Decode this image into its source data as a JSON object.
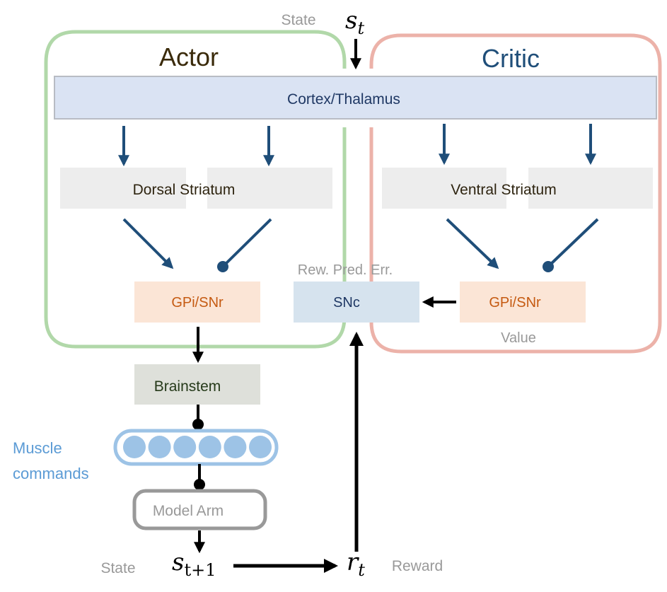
{
  "top": {
    "state_label": "State",
    "state_symbol": "s",
    "state_sub": "t"
  },
  "actor": {
    "title": "Actor",
    "striatum": "Dorsal Striatum",
    "gpi": "GPi/SNr"
  },
  "critic": {
    "title": "Critic",
    "striatum": "Ventral Striatum",
    "gpi": "GPi/SNr",
    "value_label": "Value"
  },
  "cortex": "Cortex/Thalamus",
  "snc": {
    "label": "SNc",
    "caption": "Rew. Pred. Err."
  },
  "brainstem": "Brainstem",
  "muscle": {
    "line1": "Muscle",
    "line2": "commands",
    "units": 6
  },
  "model_arm": "Model Arm",
  "bottom": {
    "state_label": "State",
    "state_symbol": "s",
    "state_sub": "t+1",
    "reward_symbol": "r",
    "reward_sub": "t",
    "reward_label": "Reward"
  },
  "colors": {
    "actor_frame": "#a9d4a0",
    "critic_frame": "#eaaaa0",
    "arrow_blue": "#1f4e79",
    "cortex_fill": "#dae3f3",
    "striatum_fill": "#ededed",
    "gpi_fill": "#fbe5d6",
    "gpi_text": "#c55a11",
    "snc_fill": "#d6e3ee",
    "brainstem_fill": "#dee0da",
    "muscle": "#9dc3e6"
  }
}
